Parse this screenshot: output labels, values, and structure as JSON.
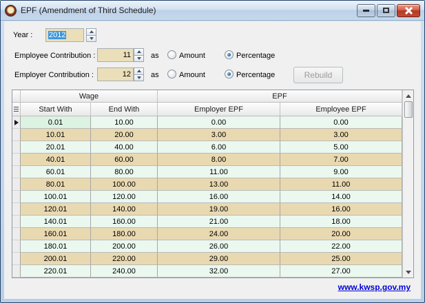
{
  "window": {
    "title": "EPF (Amendment of Third Schedule)"
  },
  "form": {
    "year": {
      "label": "Year :",
      "value": "2012"
    },
    "employee_contribution": {
      "label": "Employee Contribution :",
      "value": "11",
      "as": "as",
      "options": [
        "Amount",
        "Percentage"
      ],
      "selected": "Percentage"
    },
    "employer_contribution": {
      "label": "Employer Contribution :",
      "value": "12",
      "as": "as",
      "options": [
        "Amount",
        "Percentage"
      ],
      "selected": "Percentage"
    },
    "rebuild_button": {
      "label": "Rebuild",
      "enabled": false
    }
  },
  "grid": {
    "bands": [
      "Wage",
      "EPF"
    ],
    "columns": [
      "Start With",
      "End With",
      "Employer EPF",
      "Employee EPF"
    ],
    "selected_row_index": 0,
    "rows": [
      [
        "0.01",
        "10.00",
        "0.00",
        "0.00"
      ],
      [
        "10.01",
        "20.00",
        "3.00",
        "3.00"
      ],
      [
        "20.01",
        "40.00",
        "6.00",
        "5.00"
      ],
      [
        "40.01",
        "60.00",
        "8.00",
        "7.00"
      ],
      [
        "60.01",
        "80.00",
        "11.00",
        "9.00"
      ],
      [
        "80.01",
        "100.00",
        "13.00",
        "11.00"
      ],
      [
        "100.01",
        "120.00",
        "16.00",
        "14.00"
      ],
      [
        "120.01",
        "140.00",
        "19.00",
        "16.00"
      ],
      [
        "140.01",
        "160.00",
        "21.00",
        "18.00"
      ],
      [
        "160.01",
        "180.00",
        "24.00",
        "20.00"
      ],
      [
        "180.01",
        "200.00",
        "26.00",
        "22.00"
      ],
      [
        "200.01",
        "220.00",
        "29.00",
        "25.00"
      ],
      [
        "220.01",
        "240.00",
        "32.00",
        "27.00"
      ]
    ]
  },
  "footer": {
    "link": "www.kwsp.gov.my"
  },
  "colors": {
    "row_green": "#eaf8ef",
    "row_tan": "#e9d9b1",
    "active_cell": "#dcf2e2",
    "input_bg": "#ebdfba",
    "selection": "#3c96dc",
    "link": "#0000d6"
  }
}
